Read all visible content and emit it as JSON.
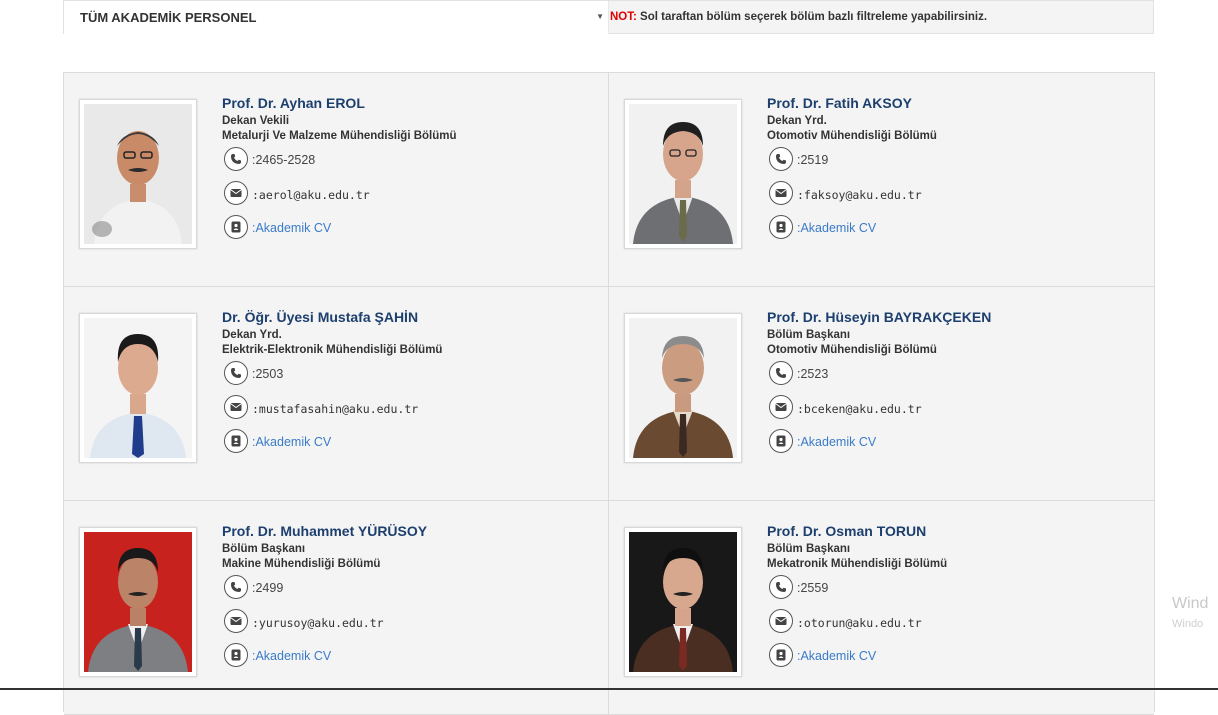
{
  "filter": {
    "selected": "TÜM AKADEMİK PERSONEL",
    "note_label": "NOT:",
    "note_text": " Sol taraftan bölüm seçerek bölüm bazlı filtreleme yapabilirsiniz."
  },
  "colors": {
    "accent": "#1d3f6e",
    "link": "#3a7bc8",
    "note_red": "#e00000"
  },
  "icons": {
    "phone": "phone-icon",
    "email": "envelope-icon",
    "cv": "address-card-icon",
    "caret": "caret-down-icon"
  },
  "staff": [
    {
      "name": "Prof. Dr. Ayhan EROL",
      "title": "Dekan Vekili",
      "dept": "Metalurji Ve Malzeme Mühendisliği Bölümü",
      "phone": ":2465-2528",
      "email": ":aerol@aku.edu.tr",
      "cv": ":Akademik CV"
    },
    {
      "name": "Prof. Dr. Fatih AKSOY",
      "title": "Dekan Yrd.",
      "dept": "Otomotiv Mühendisliği Bölümü",
      "phone": ":2519",
      "email": ":faksoy@aku.edu.tr",
      "cv": ":Akademik CV"
    },
    {
      "name": "Dr. Öğr. Üyesi Mustafa ŞAHİN",
      "title": "Dekan Yrd.",
      "dept": "Elektrik-Elektronik Mühendisliği Bölümü",
      "phone": ":2503",
      "email": ":mustafasahin@aku.edu.tr",
      "cv": ":Akademik CV"
    },
    {
      "name": "Prof. Dr. Hüseyin BAYRAKÇEKEN",
      "title": "Bölüm Başkanı",
      "dept": "Otomotiv Mühendisliği Bölümü",
      "phone": ":2523",
      "email": ":bceken@aku.edu.tr",
      "cv": ":Akademik CV"
    },
    {
      "name": "Prof. Dr. Muhammet YÜRÜSOY",
      "title": "Bölüm Başkanı",
      "dept": "Makine Mühendisliği Bölümü",
      "phone": ":2499",
      "email": ":yurusoy@aku.edu.tr",
      "cv": ":Akademik CV"
    },
    {
      "name": "Prof. Dr. Osman TORUN",
      "title": "Bölüm Başkanı",
      "dept": "Mekatronik Mühendisliği Bölümü",
      "phone": ":2559",
      "email": ":otorun@aku.edu.tr",
      "cv": ":Akademik CV"
    }
  ],
  "watermark": {
    "line1": "Wind",
    "line2": "Windo"
  }
}
